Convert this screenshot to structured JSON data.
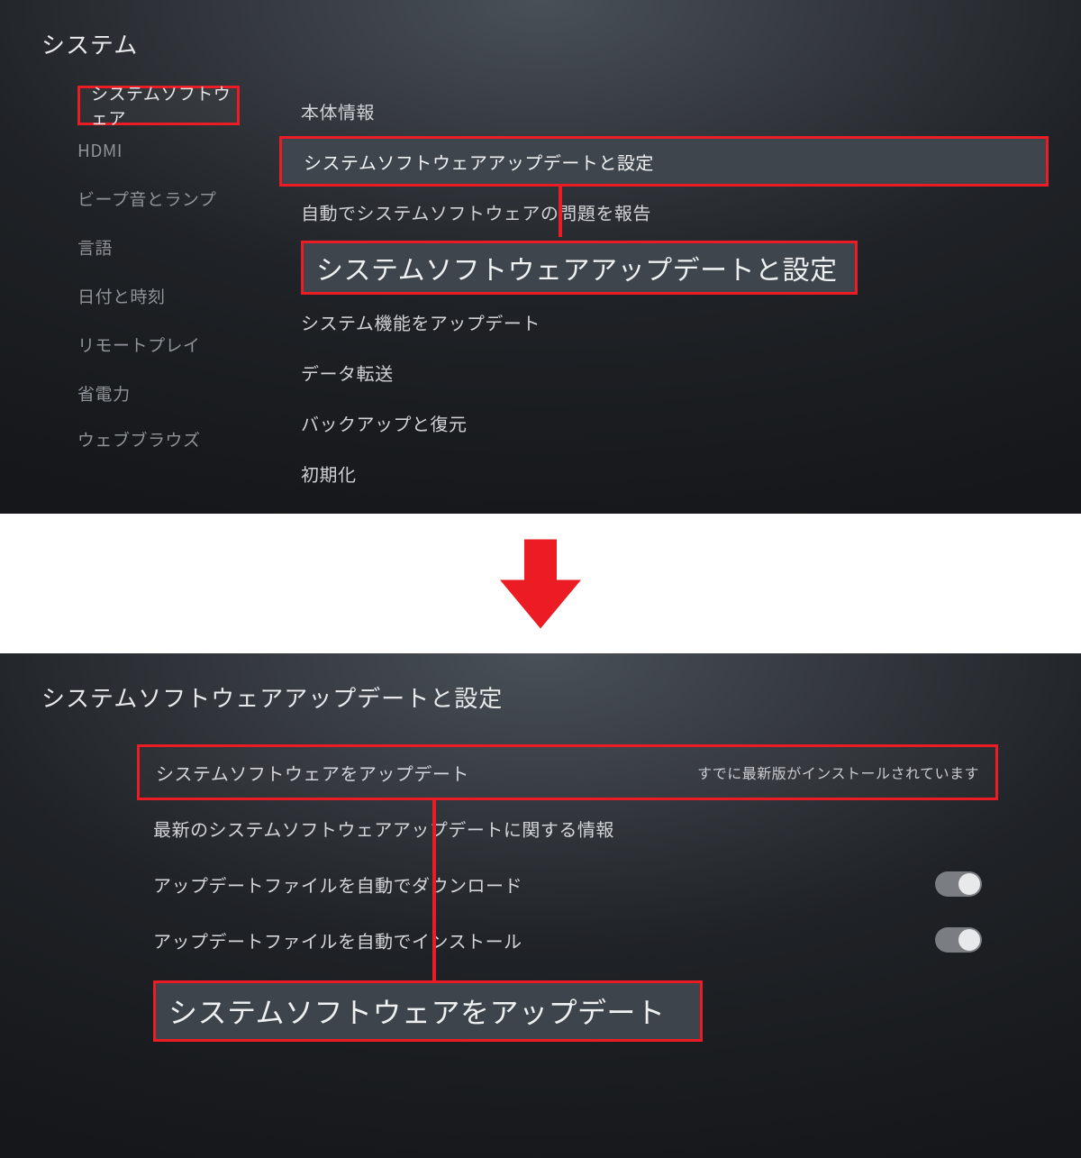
{
  "top": {
    "title": "システム",
    "sidebar": [
      {
        "label": "システムソフトウェア",
        "selected": true
      },
      {
        "label": "HDMI"
      },
      {
        "label": "ビープ音とランプ"
      },
      {
        "label": "言語"
      },
      {
        "label": "日付と時刻"
      },
      {
        "label": "リモートプレイ"
      },
      {
        "label": "省電力"
      },
      {
        "label": "ウェブブラウズ"
      }
    ],
    "main": {
      "rows": [
        "本体情報",
        "システムソフトウェアアップデートと設定",
        "自動でシステムソフトウェアの問題を報告",
        "システム機能をアップデート",
        "データ転送",
        "バックアップと復元",
        "初期化"
      ],
      "callout": "システムソフトウェアアップデートと設定"
    }
  },
  "bottom": {
    "title": "システムソフトウェアアップデートと設定",
    "rows": {
      "update": {
        "label": "システムソフトウェアをアップデート",
        "status": "すでに最新版がインストールされています"
      },
      "info": {
        "label": "最新のシステムソフトウェアアップデートに関する情報"
      },
      "auto_dl": {
        "label": "アップデートファイルを自動でダウンロード",
        "toggle": "on"
      },
      "auto_inst": {
        "label": "アップデートファイルを自動でインストール",
        "toggle": "on"
      }
    },
    "callout": "システムソフトウェアをアップデート"
  }
}
